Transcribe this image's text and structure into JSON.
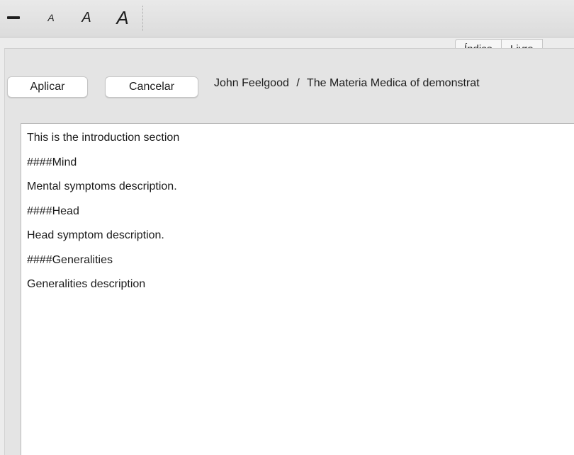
{
  "toolbar": {
    "buttons": [
      {
        "id": "zoom-out",
        "label": "",
        "icon": "minus-icon"
      },
      {
        "id": "font-small",
        "label": "A"
      },
      {
        "id": "font-medium",
        "label": "A"
      },
      {
        "id": "font-large",
        "label": "A"
      }
    ]
  },
  "tabs": [
    {
      "label": "Índice"
    },
    {
      "label": "Livro"
    }
  ],
  "actions": {
    "apply_label": "Aplicar",
    "cancel_label": "Cancelar"
  },
  "breadcrumb": {
    "author": "John Feelgood",
    "separator": "/",
    "title": "The Materia Medica of demonstrat"
  },
  "editor": {
    "lines": [
      "This is the introduction section",
      "####Mind",
      "Mental symptoms description.",
      "####Head",
      "Head symptom description.",
      "####Generalities",
      "Generalities description"
    ]
  }
}
